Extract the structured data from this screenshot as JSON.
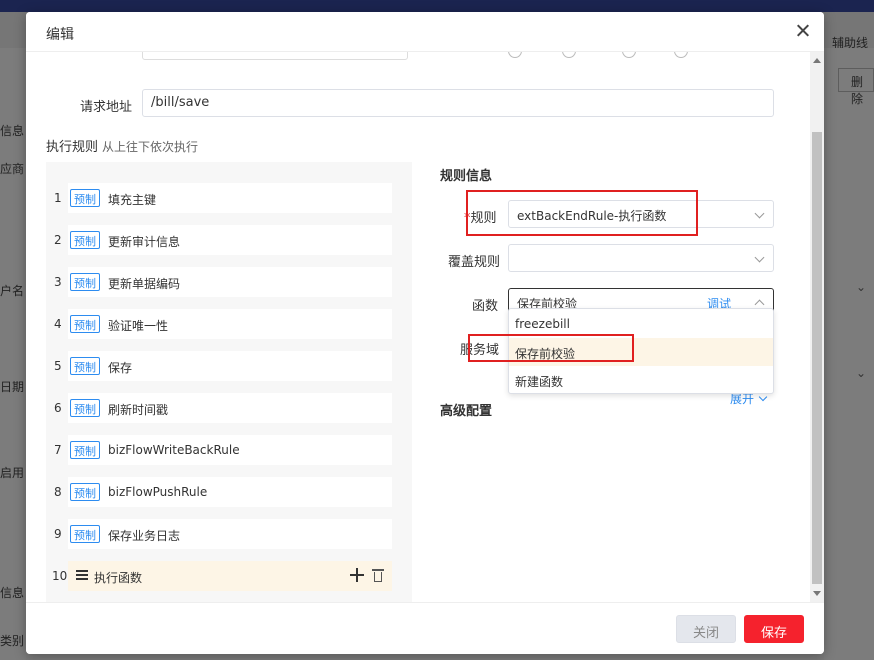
{
  "background": {
    "tab_label": "辅助线",
    "delete_label": "删除",
    "left_fragments": [
      "信息",
      "应商",
      "户名",
      "日期",
      "启用",
      "信息",
      "类别"
    ]
  },
  "modal": {
    "title": "编辑",
    "request_url_label": "请求地址",
    "request_url_value": "/bill/save",
    "rules_title": "执行规则",
    "rules_subtitle": "从上往下依次执行",
    "rules": [
      {
        "num": "1",
        "tag": "预制",
        "label": "填充主键"
      },
      {
        "num": "2",
        "tag": "预制",
        "label": "更新审计信息"
      },
      {
        "num": "3",
        "tag": "预制",
        "label": "更新单据编码"
      },
      {
        "num": "4",
        "tag": "预制",
        "label": "验证唯一性"
      },
      {
        "num": "5",
        "tag": "预制",
        "label": "保存"
      },
      {
        "num": "6",
        "tag": "预制",
        "label": "刷新时间戳"
      },
      {
        "num": "7",
        "tag": "预制",
        "label": "bizFlowWriteBackRule"
      },
      {
        "num": "8",
        "tag": "预制",
        "label": "bizFlowPushRule"
      },
      {
        "num": "9",
        "tag": "预制",
        "label": "保存业务日志"
      }
    ],
    "active_rule": {
      "num": "10",
      "label": "执行函数"
    },
    "rule_info_title": "规则信息",
    "rule_label": "规则",
    "rule_value": "extBackEndRule-执行函数",
    "override_label": "覆盖规则",
    "override_value": "",
    "function_label": "函数",
    "function_value": "保存前校验",
    "debug_link": "调试",
    "service_domain_label": "服务域",
    "function_options": [
      "freezebill",
      "保存前校验",
      "新建函数"
    ],
    "advanced_title": "高级配置",
    "expand_link": "展开",
    "close_button": "关闭",
    "save_button": "保存"
  },
  "colors": {
    "accent": "#2d8cf0",
    "save": "#f5222d",
    "highlight": "#e02020"
  }
}
